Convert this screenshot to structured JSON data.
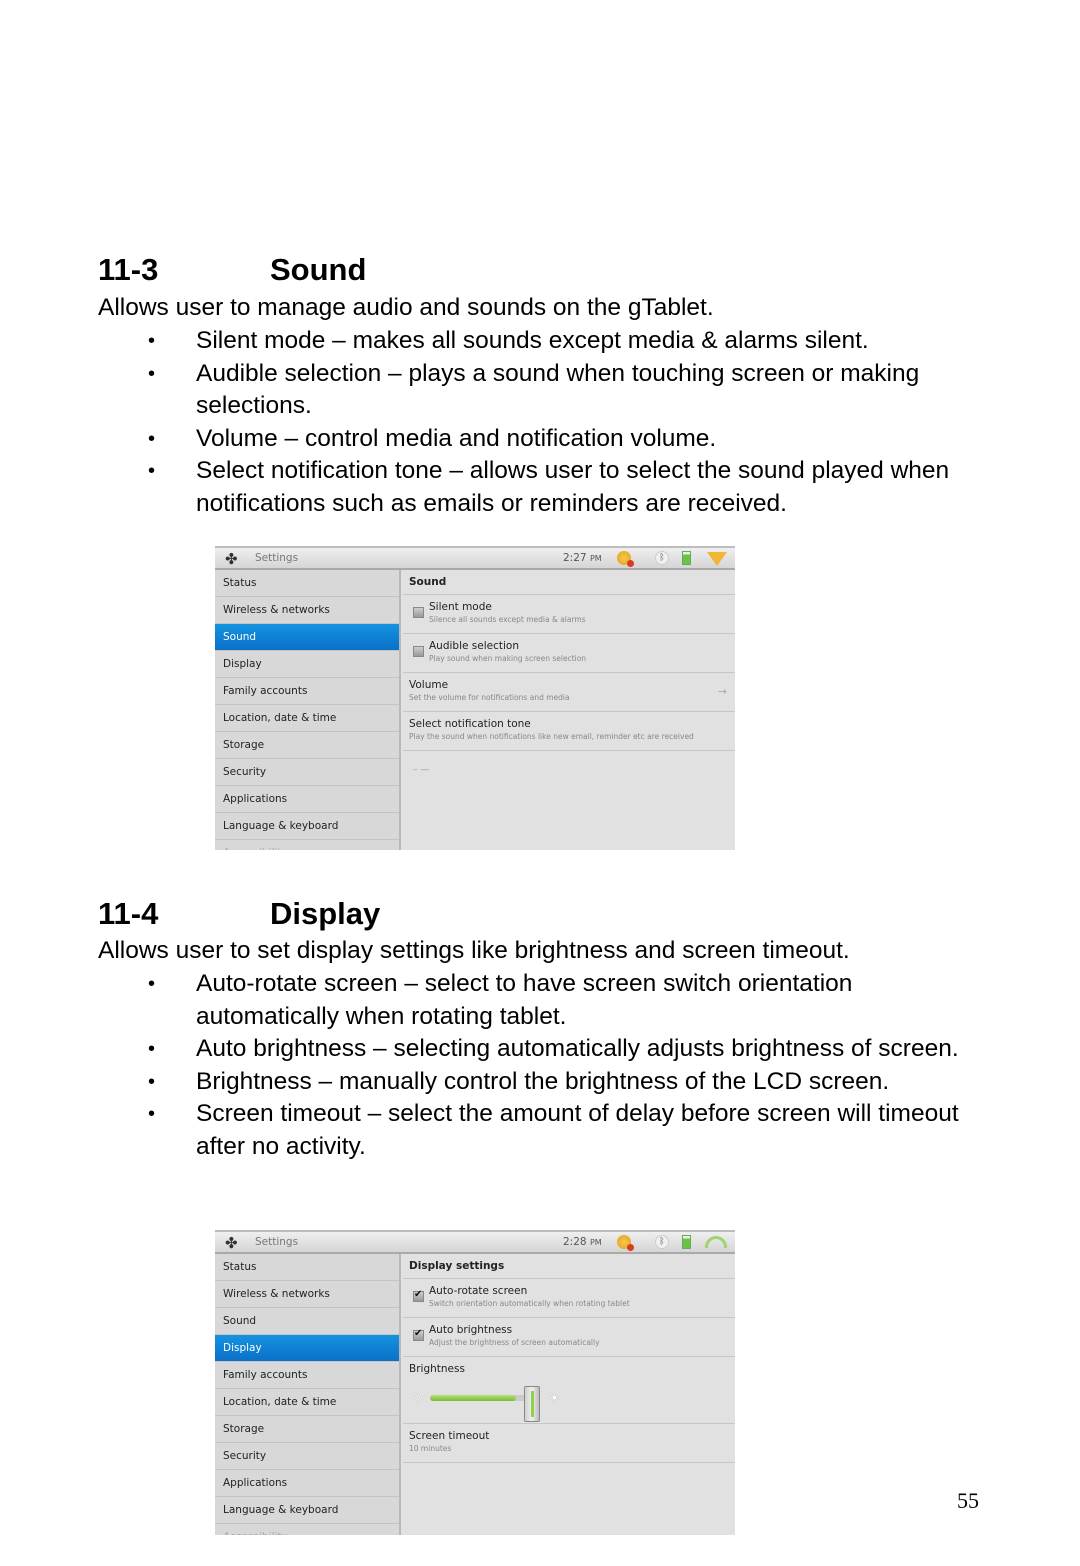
{
  "sound_section": {
    "number": "11-3",
    "title": "Sound",
    "intro": "Allows user to manage audio and sounds on the gTablet.",
    "bullets": [
      "Silent mode – makes all sounds except media & alarms silent.",
      "Audible selection – plays a sound when touching screen or making selections.",
      "Volume – control media and notification volume.",
      "Select notification tone – allows user to select the sound played when notifications such as emails or reminders are received."
    ],
    "screenshot": {
      "app_title": "Settings",
      "time": "2:27",
      "ampm": "PM",
      "status_icons": [
        "alert-icon",
        "bluetooth-icon",
        "battery-icon",
        "warning-icon"
      ],
      "menu": [
        "Status",
        "Wireless & networks",
        "Sound",
        "Display",
        "Family accounts",
        "Location, date & time",
        "Storage",
        "Security",
        "Applications",
        "Language & keyboard",
        "Accessibility"
      ],
      "active_menu": "Sound",
      "panel_header": "Sound",
      "prefs": [
        {
          "title": "Silent mode",
          "summary": "Silence all sounds except media & alarms",
          "checkbox": true,
          "checked": false
        },
        {
          "title": "Audible selection",
          "summary": "Play sound when making screen selection",
          "checkbox": true,
          "checked": false
        },
        {
          "title": "Volume",
          "summary": "Set the volume for notifications and media",
          "checkbox": false,
          "arrow": "→"
        },
        {
          "title": "Select notification tone",
          "summary": "Play the sound when notifications like new email, reminder etc are received",
          "checkbox": false
        }
      ],
      "dashes": "–   —"
    }
  },
  "display_section": {
    "number": "11-4",
    "title": "Display",
    "intro": "Allows user to set display settings like brightness and screen timeout.",
    "bullets": [
      "Auto-rotate screen – select to have screen switch orientation automatically when rotating tablet.",
      "Auto brightness – selecting automatically adjusts brightness of screen.",
      "Brightness – manually control the brightness of the LCD screen.",
      "Screen timeout – select the amount of delay before screen will timeout after no activity."
    ],
    "screenshot": {
      "app_title": "Settings",
      "time": "2:28",
      "ampm": "PM",
      "status_icons": [
        "alert-icon",
        "bluetooth-icon",
        "battery-icon",
        "wifi-icon"
      ],
      "menu": [
        "Status",
        "Wireless & networks",
        "Sound",
        "Display",
        "Family accounts",
        "Location, date & time",
        "Storage",
        "Security",
        "Applications",
        "Language & keyboard",
        "Accessibility"
      ],
      "active_menu": "Display",
      "panel_header": "Display settings",
      "prefs": [
        {
          "title": "Auto-rotate screen",
          "summary": "Switch orientation automatically when rotating tablet",
          "checkbox": true,
          "checked": true
        },
        {
          "title": "Auto brightness",
          "summary": "Adjust the brightness of screen automatically",
          "checkbox": true,
          "checked": true
        }
      ],
      "brightness": {
        "title": "Brightness",
        "level_percent": 82,
        "min_icon": "☼",
        "max_icon": "☀"
      },
      "screen_timeout": {
        "title": "Screen timeout",
        "summary": "10 minutes"
      }
    }
  },
  "page_number": "55",
  "bullet_glyph": "•"
}
